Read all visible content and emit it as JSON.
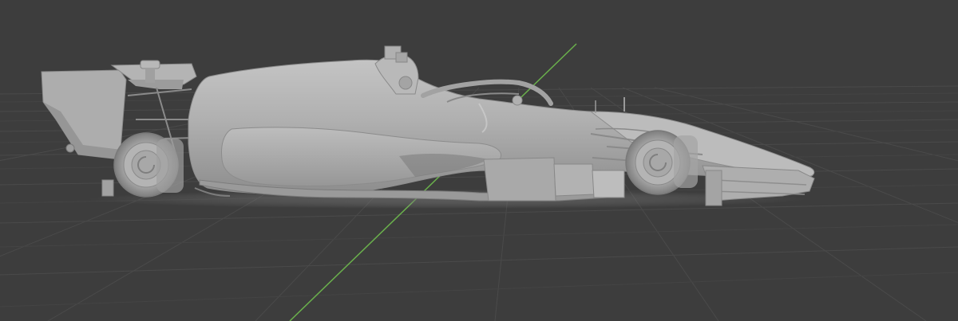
{
  "viewport": {
    "mode": "3d-viewport",
    "background_color": "#3d3d3d",
    "grid_color": "#4a4a4a",
    "grid_minor_color": "#444444",
    "y_axis_color": "#6ab04c",
    "model_color": "#a9a9a9",
    "model_name": "formula-car",
    "shading": "solid",
    "view": "side"
  }
}
